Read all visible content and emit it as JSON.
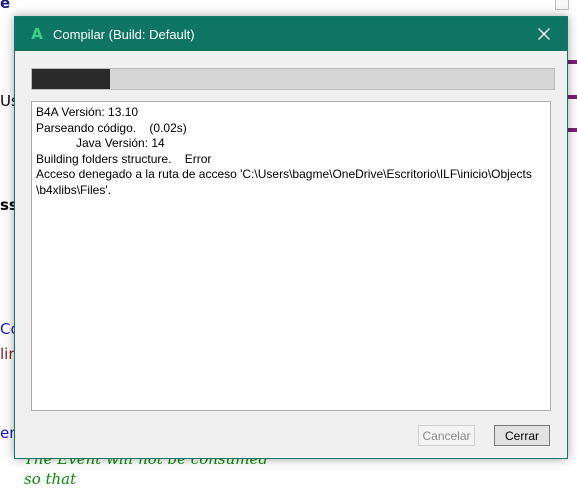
{
  "dialog": {
    "title": "Compilar (Build: Default)",
    "app_icon_glyph": "A",
    "accent_color": "#0e7463",
    "progress": 0.15,
    "log_lines": [
      "B4A Versión: 13.10",
      "Parseando código.    (0.02s)",
      "            Java Versión: 14",
      "Building folders structure.    Error",
      "Acceso denegado a la ruta de acceso 'C:\\Users\\bagme\\OneDrive\\Escritorio\\ILF\\inicio\\Objects",
      "\\b4xlibs\\Files'."
    ],
    "buttons": {
      "cancel": "Cancelar",
      "close": "Cerrar"
    }
  },
  "background": {
    "fragments": {
      "e": "e",
      "us": "Us",
      "ss": "ss",
      "coc": "Coc",
      "lir": "lir",
      "en": "en'",
      "event": "The Event will not be consumed",
      "tail": "so that"
    }
  }
}
